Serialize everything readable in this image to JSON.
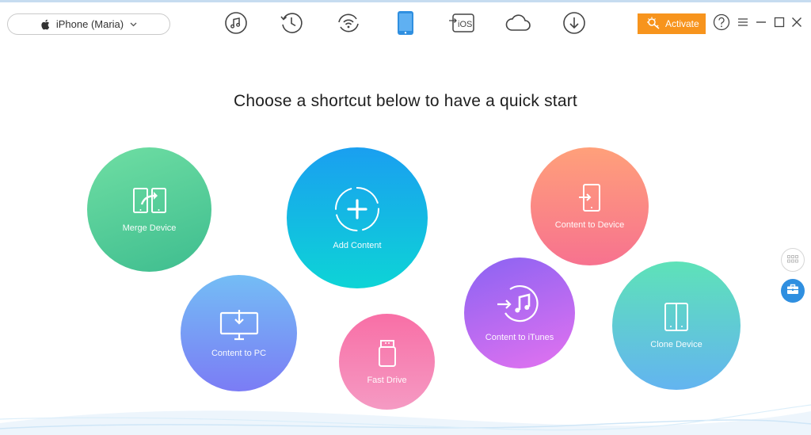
{
  "device": {
    "name": "iPhone (Maria)"
  },
  "toolbar": {
    "tools": [
      {
        "icon": "music-icon"
      },
      {
        "icon": "history-icon"
      },
      {
        "icon": "wifi-sync-icon"
      },
      {
        "icon": "phone-icon"
      },
      {
        "icon": "ios-icon",
        "text": "iOS"
      },
      {
        "icon": "cloud-icon"
      },
      {
        "icon": "download-icon"
      }
    ],
    "activate_label": "Activate"
  },
  "headline": "Choose a shortcut below to have a quick start",
  "shortcuts": {
    "merge": "Merge Device",
    "add": "Add Content",
    "content_to_device": "Content to Device",
    "content_to_pc": "Content to PC",
    "fast_drive": "Fast Drive",
    "content_to_itunes": "Content to iTunes",
    "clone": "Clone Device"
  },
  "colors": {
    "accent": "#f7941d",
    "active_tool": "#2f8fe0"
  }
}
